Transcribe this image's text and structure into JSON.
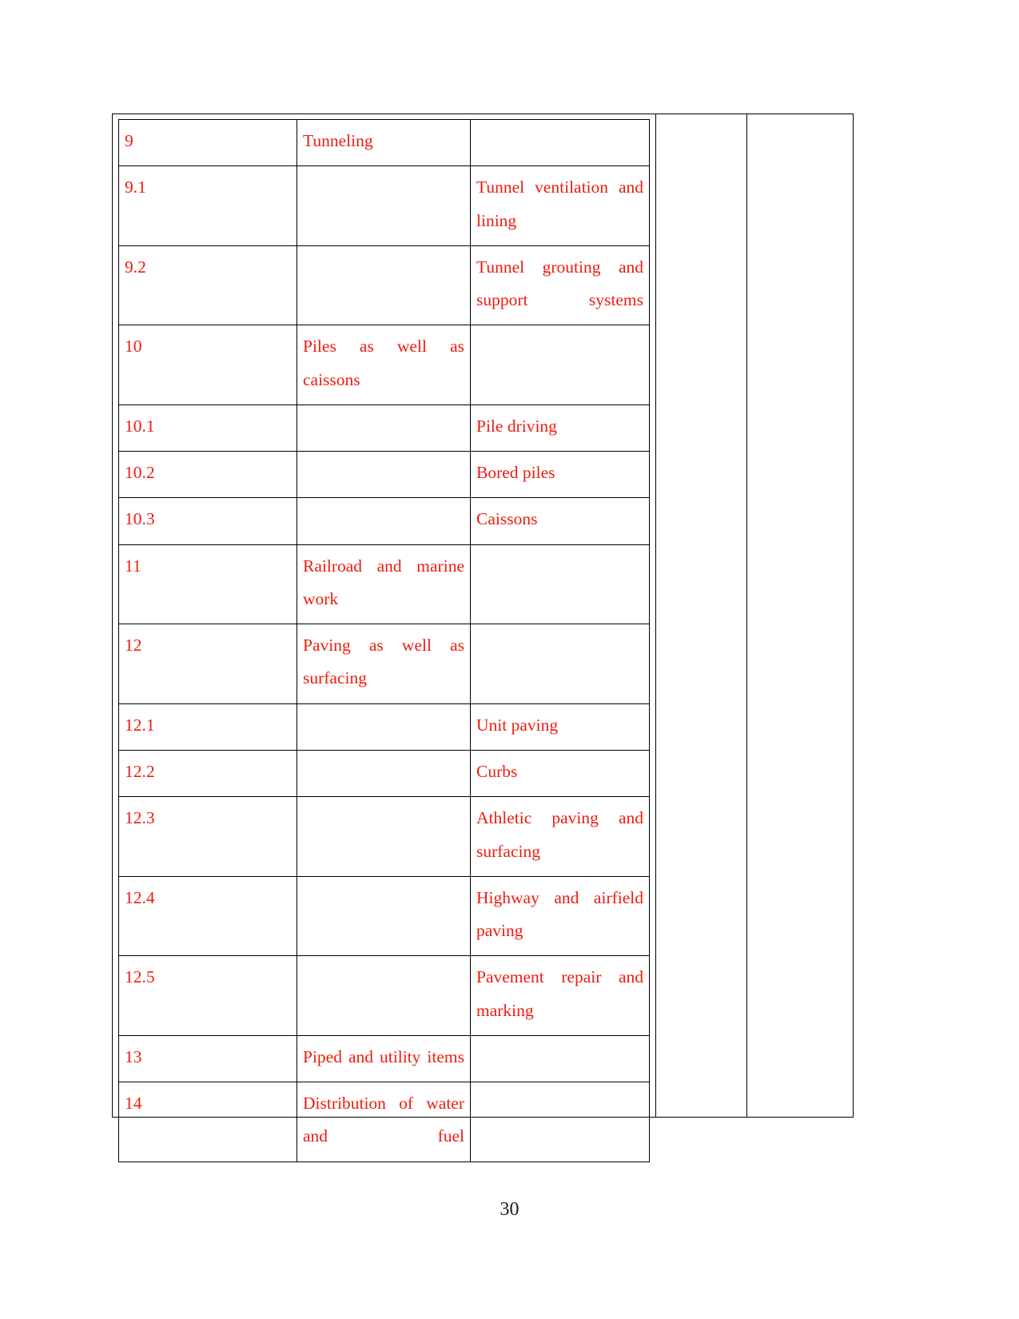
{
  "document": {
    "page_number": "30",
    "text_color": "#ED1C10",
    "border_color": "#000000",
    "page_number_color": "#1a1a1a"
  },
  "table": {
    "column_count": 5,
    "rows": [
      {
        "code": "9",
        "category": "Tunneling",
        "item": ""
      },
      {
        "code": "9.1",
        "category": "",
        "item": "Tunnel ventilation and lining"
      },
      {
        "code": "9.2",
        "category": "",
        "item": "Tunnel grouting and support systems"
      },
      {
        "code": "10",
        "category": "Piles as well as caissons",
        "item": ""
      },
      {
        "code": "10.1",
        "category": "",
        "item": "Pile driving"
      },
      {
        "code": "10.2",
        "category": "",
        "item": "Bored piles"
      },
      {
        "code": "10.3",
        "category": "",
        "item": "Caissons"
      },
      {
        "code": "11",
        "category": "Railroad and marine work",
        "item": ""
      },
      {
        "code": "12",
        "category": "Paving as well as surfacing",
        "item": ""
      },
      {
        "code": "12.1",
        "category": "",
        "item": "Unit paving"
      },
      {
        "code": "12.2",
        "category": "",
        "item": "Curbs"
      },
      {
        "code": "12.3",
        "category": "",
        "item": "Athletic paving and surfacing"
      },
      {
        "code": "12.4",
        "category": "",
        "item": "Highway and airfield paving"
      },
      {
        "code": "12.5",
        "category": "",
        "item": "Pavement repair and marking"
      },
      {
        "code": "13",
        "category": "Piped and utility items",
        "item": ""
      },
      {
        "code": "14",
        "category": "Distribution of water and fuel",
        "item": ""
      }
    ]
  }
}
